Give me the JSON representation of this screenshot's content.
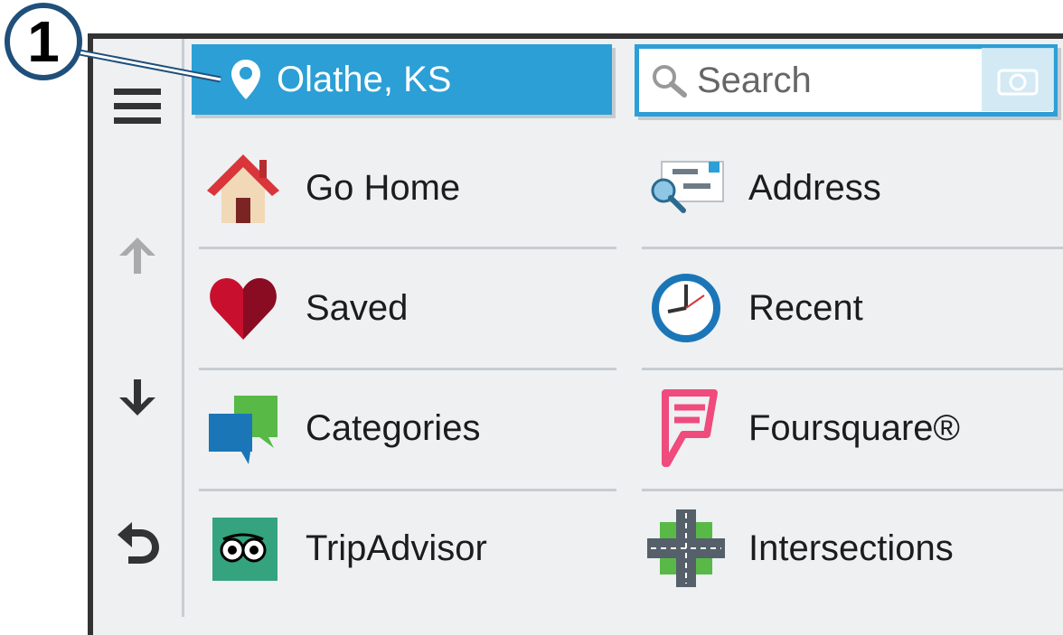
{
  "callout": {
    "number": "1"
  },
  "location_button": {
    "label": "Olathe, KS",
    "icon": "location-pin-icon"
  },
  "search": {
    "placeholder": "Search",
    "icon": "search-icon"
  },
  "rail": {
    "menu_icon": "hamburger-menu-icon",
    "up_icon": "arrow-up-icon",
    "down_icon": "arrow-down-icon",
    "back_icon": "back-icon"
  },
  "items": [
    {
      "label": "Go Home",
      "icon": "house-icon"
    },
    {
      "label": "Address",
      "icon": "address-search-icon"
    },
    {
      "label": "Saved",
      "icon": "heart-icon"
    },
    {
      "label": "Recent",
      "icon": "clock-icon"
    },
    {
      "label": "Categories",
      "icon": "speech-bubbles-icon"
    },
    {
      "label": "Foursquare®",
      "icon": "foursquare-icon"
    },
    {
      "label": "TripAdvisor",
      "icon": "tripadvisor-icon"
    },
    {
      "label": "Intersections",
      "icon": "intersection-icon"
    }
  ],
  "colors": {
    "accent": "#2b9fd6",
    "callout_border": "#1f4f7a",
    "background": "#eef0f2"
  }
}
